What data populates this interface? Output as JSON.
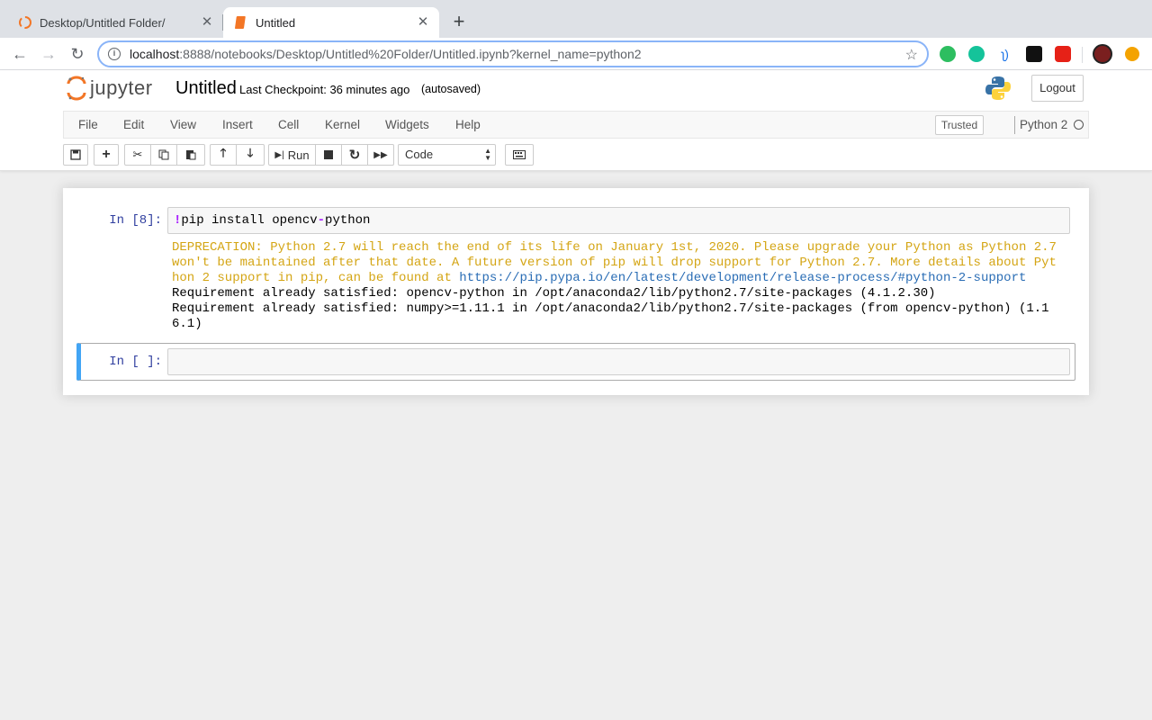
{
  "browser": {
    "tabs": [
      {
        "title": "Desktop/Untitled Folder/"
      },
      {
        "title": "Untitled"
      }
    ],
    "url_host": "localhost",
    "url_rest": ":8888/notebooks/Desktop/Untitled%20Folder/Untitled.ipynb?kernel_name=python2"
  },
  "header": {
    "logo_text": "jupyter",
    "notebook_title": "Untitled",
    "checkpoint": "Last Checkpoint: 36 minutes ago",
    "autosave": "(autosaved)",
    "logout": "Logout"
  },
  "menu": {
    "items": [
      "File",
      "Edit",
      "View",
      "Insert",
      "Cell",
      "Kernel",
      "Widgets",
      "Help"
    ],
    "trusted": "Trusted",
    "kernel": "Python 2"
  },
  "toolbar": {
    "run_label": "Run",
    "cell_type": "Code"
  },
  "cells": [
    {
      "prompt": "In [8]:",
      "code_bang": "!",
      "code_a": "pip install opencv",
      "code_dash": "-",
      "code_b": "python",
      "output": {
        "warn_line1": "DEPRECATION: Python 2.7 will reach the end of its life on January 1st, 2020. Please upgrade your Python as Python 2.7",
        "warn_line2": "won't be maintained after that date. A future version of pip will drop support for Python 2.7. More details about Pyt",
        "warn_line3": "hon 2 support in pip, can be found at ",
        "link": "https://pip.pypa.io/en/latest/development/release-process/#python-2-support",
        "line4": "Requirement already satisfied: opencv-python in /opt/anaconda2/lib/python2.7/site-packages (4.1.2.30)",
        "line5": "Requirement already satisfied: numpy>=1.11.1 in /opt/anaconda2/lib/python2.7/site-packages (from opencv-python) (1.1",
        "line6": "6.1)"
      }
    },
    {
      "prompt": "In [ ]:"
    }
  ]
}
